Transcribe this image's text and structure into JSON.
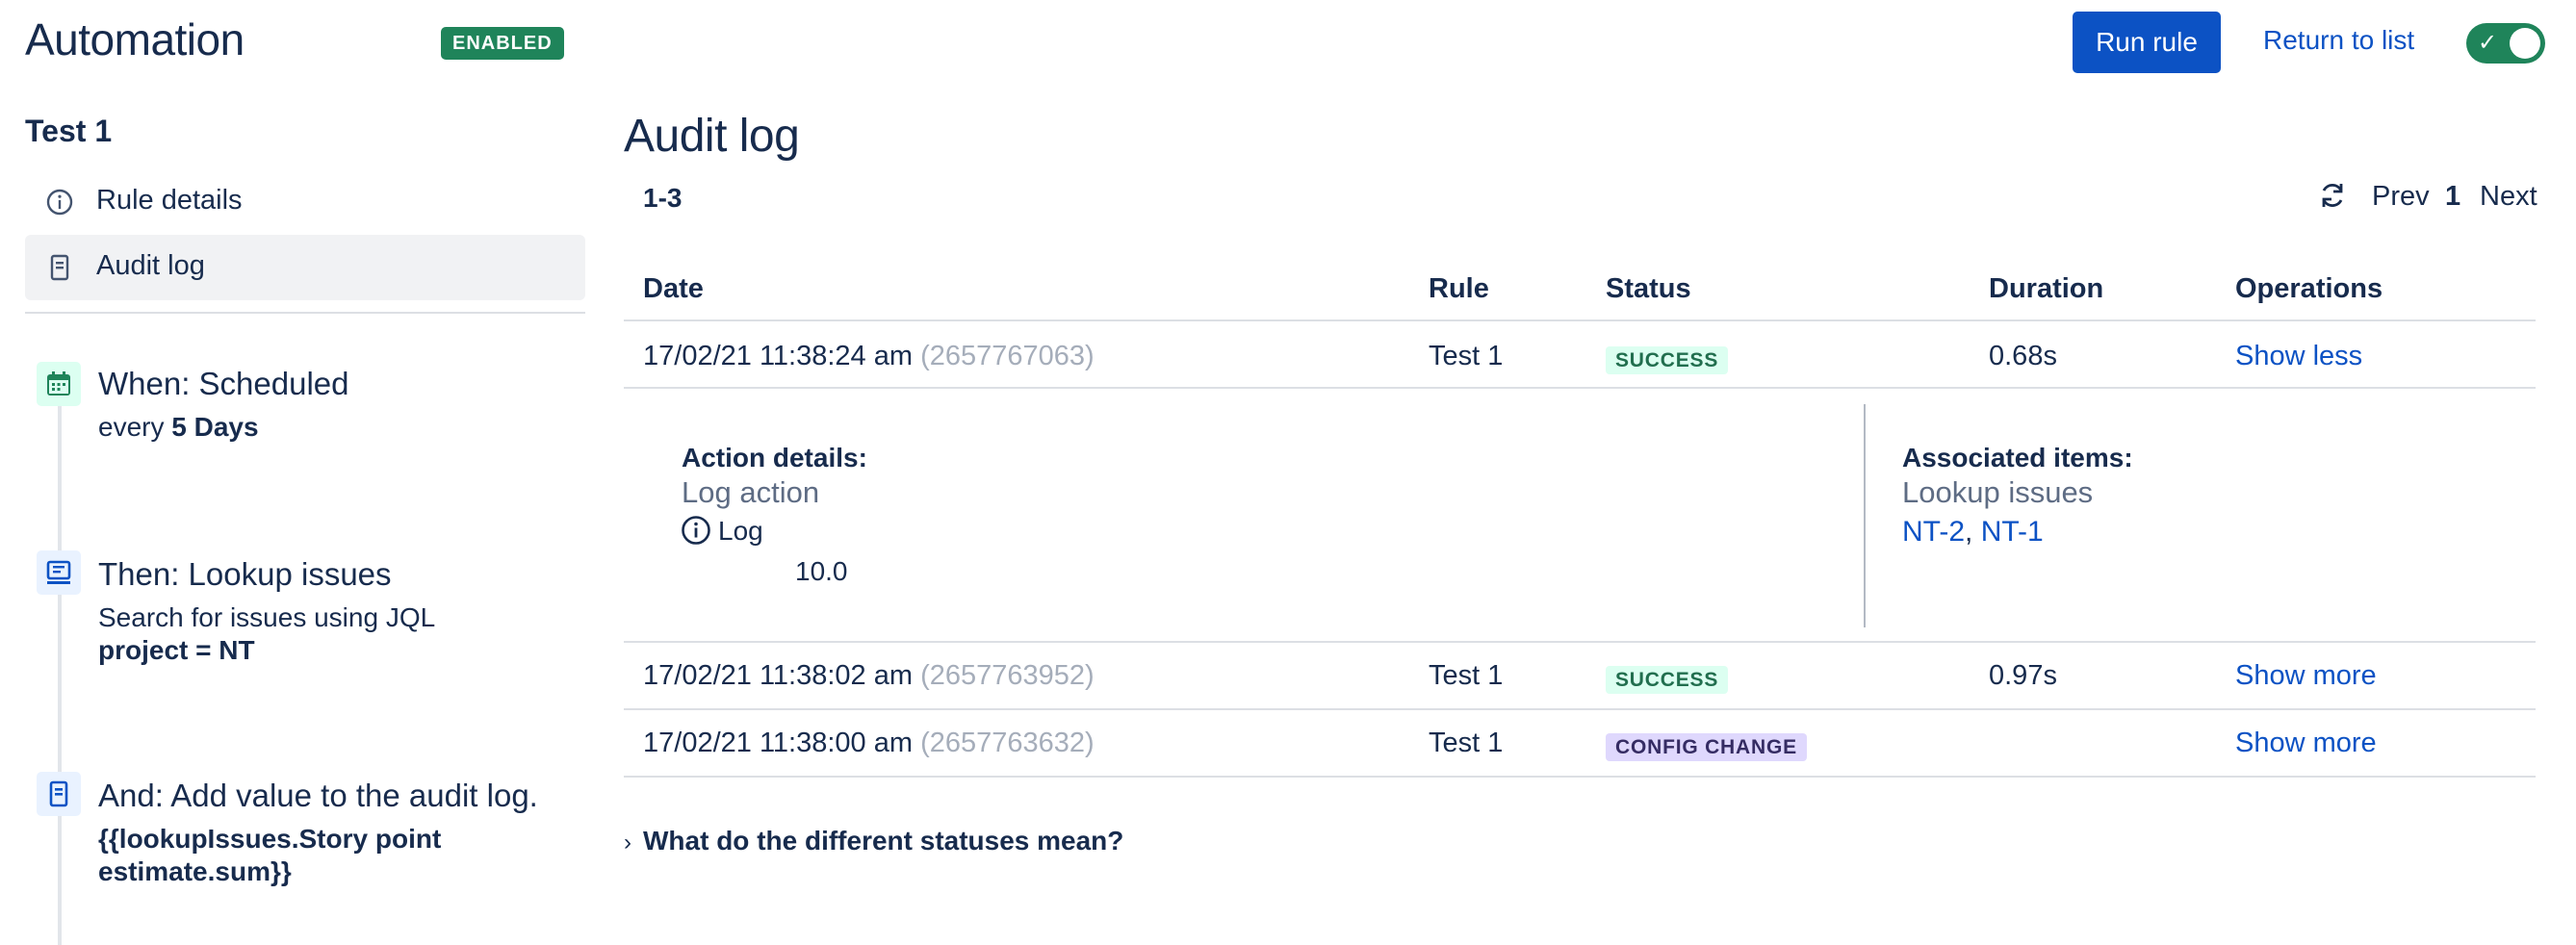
{
  "header": {
    "title": "Automation",
    "status_badge": "ENABLED",
    "run_rule_label": "Run rule",
    "return_label": "Return to list",
    "toggle_state": "on"
  },
  "sidebar": {
    "rule_name": "Test 1",
    "nav": [
      {
        "label": "Rule details",
        "icon": "info-icon",
        "active": false
      },
      {
        "label": "Audit log",
        "icon": "document-icon",
        "active": true
      }
    ],
    "components": [
      {
        "icon": "calendar-icon",
        "title": "When: Scheduled",
        "sub_prefix": "every ",
        "sub_bold": "5 Days"
      },
      {
        "icon": "search-list-icon",
        "title": "Then: Lookup issues",
        "sub_line1": "Search for issues using JQL",
        "sub_bold": "project = NT"
      },
      {
        "icon": "document-icon",
        "title": "And: Add value to the audit log.",
        "sub_bold_line1": "{{lookupIssues.Story point",
        "sub_bold_line2": "estimate.sum}}"
      }
    ]
  },
  "main": {
    "title": "Audit log",
    "range": "1-3",
    "pagination": {
      "prev": "Prev",
      "page": "1",
      "next": "Next"
    },
    "columns": [
      "Date",
      "Rule",
      "Status",
      "Duration",
      "Operations"
    ],
    "rows": [
      {
        "date": "17/02/21 11:38:24 am",
        "id": "(2657767063)",
        "rule": "Test 1",
        "status": "SUCCESS",
        "duration": "0.68s",
        "operation": "Show less"
      },
      {
        "date": "17/02/21 11:38:02 am",
        "id": "(2657763952)",
        "rule": "Test 1",
        "status": "SUCCESS",
        "duration": "0.97s",
        "operation": "Show more"
      },
      {
        "date": "17/02/21 11:38:00 am",
        "id": "(2657763632)",
        "rule": "Test 1",
        "status": "CONFIG CHANGE",
        "duration": "",
        "operation": "Show more"
      }
    ],
    "expanded": {
      "action_label": "Action details:",
      "action_value": "Log action",
      "log_label": "Log",
      "log_value": "10.0",
      "assoc_label": "Associated items:",
      "assoc_value": "Lookup issues",
      "links": [
        "NT-2",
        "NT-1"
      ],
      "separator": ","
    },
    "faq": "What do the different statuses mean?"
  },
  "colors": {
    "primary": "#0c52c4",
    "success": "#1f845a",
    "text": "#172b4d"
  }
}
